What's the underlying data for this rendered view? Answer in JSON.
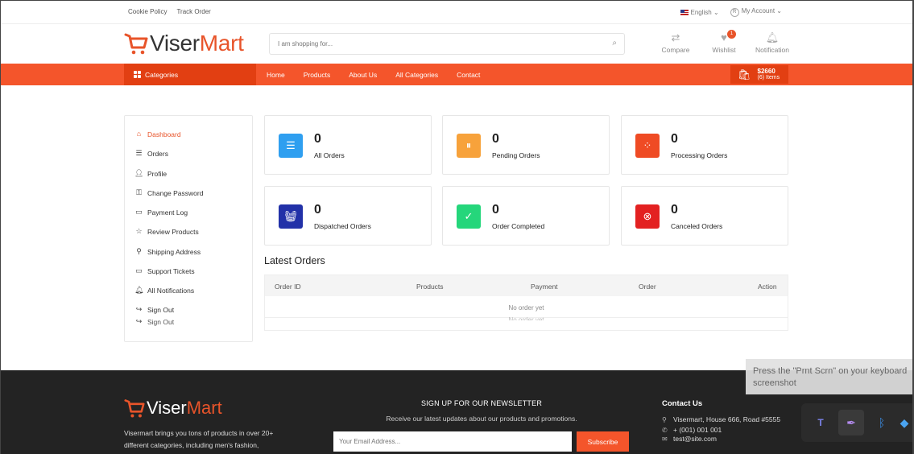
{
  "topbar": {
    "links": [
      "Cookie Policy",
      "Track Order"
    ],
    "language": "English",
    "account": "My Account"
  },
  "header": {
    "brand_part1": "Viser",
    "brand_part2": "Mart",
    "search_placeholder": "I am shopping for...",
    "actions": [
      {
        "label": "Compare",
        "icon": "compare-icon"
      },
      {
        "label": "Wishlist",
        "icon": "heart-icon",
        "badge": "1"
      },
      {
        "label": "Notification",
        "icon": "bell-icon"
      }
    ]
  },
  "nav": {
    "categories_label": "Categories",
    "links": [
      "Home",
      "Products",
      "About Us",
      "All Categories",
      "Contact"
    ],
    "cart_amount": "$2660",
    "cart_items": "(6) Items"
  },
  "sidebar": {
    "items": [
      {
        "label": "Dashboard",
        "icon": "home-icon"
      },
      {
        "label": "Orders",
        "icon": "list-icon"
      },
      {
        "label": "Profile",
        "icon": "user-icon"
      },
      {
        "label": "Change Password",
        "icon": "key-icon"
      },
      {
        "label": "Payment Log",
        "icon": "wallet-icon"
      },
      {
        "label": "Review Products",
        "icon": "star-icon"
      },
      {
        "label": "Shipping Address",
        "icon": "map-pin-icon"
      },
      {
        "label": "Support Tickets",
        "icon": "ticket-icon"
      },
      {
        "label": "All Notifications",
        "icon": "bell-icon"
      },
      {
        "label": "Sign Out",
        "icon": "sign-out-icon"
      }
    ],
    "ghost_label": "Sign Out"
  },
  "stats": [
    {
      "value": "0",
      "label": "All Orders",
      "color": "#2f9ff0",
      "icon": "list-icon"
    },
    {
      "value": "0",
      "label": "Pending Orders",
      "color": "#f7a23b",
      "icon": "pause-icon"
    },
    {
      "value": "0",
      "label": "Processing Orders",
      "color": "#ef4b24",
      "icon": "spinner-icon"
    },
    {
      "value": "0",
      "label": "Dispatched Orders",
      "color": "#2231a8",
      "icon": "basket-icon"
    },
    {
      "value": "0",
      "label": "Order Completed",
      "color": "#25d67b",
      "icon": "check-icon"
    },
    {
      "value": "0",
      "label": "Canceled Orders",
      "color": "#e32121",
      "icon": "cancel-icon"
    }
  ],
  "latest_orders": {
    "title": "Latest Orders",
    "columns": [
      "Order ID",
      "Products",
      "Payment",
      "Order",
      "Action"
    ],
    "empty_text": "No order yet"
  },
  "footer": {
    "brand_part1": "Viser",
    "brand_part2": "Mart",
    "description": "Visermart brings you tons of products in over 20+ different categories, including men's fashion,",
    "newsletter_title": "SIGN UP FOR OUR NEWSLETTER",
    "newsletter_sub": "Receive our latest updates about our products and promotions.",
    "email_placeholder": "Your Email Address...",
    "subscribe_label": "Subscribe",
    "contact_title": "Contact Us",
    "contact_address": "Visermart, House 666, Road #5555",
    "contact_phone": "+ (001) 001 001",
    "contact_email": "test@site.com"
  },
  "overlay": {
    "toast_line1": "Press the \"Prnt Scrn\" on your keyboard",
    "toast_line2": "screenshot"
  },
  "colors": {
    "accent": "#f4552b",
    "accent_dark": "#e23f12",
    "footer_bg": "#232323"
  }
}
